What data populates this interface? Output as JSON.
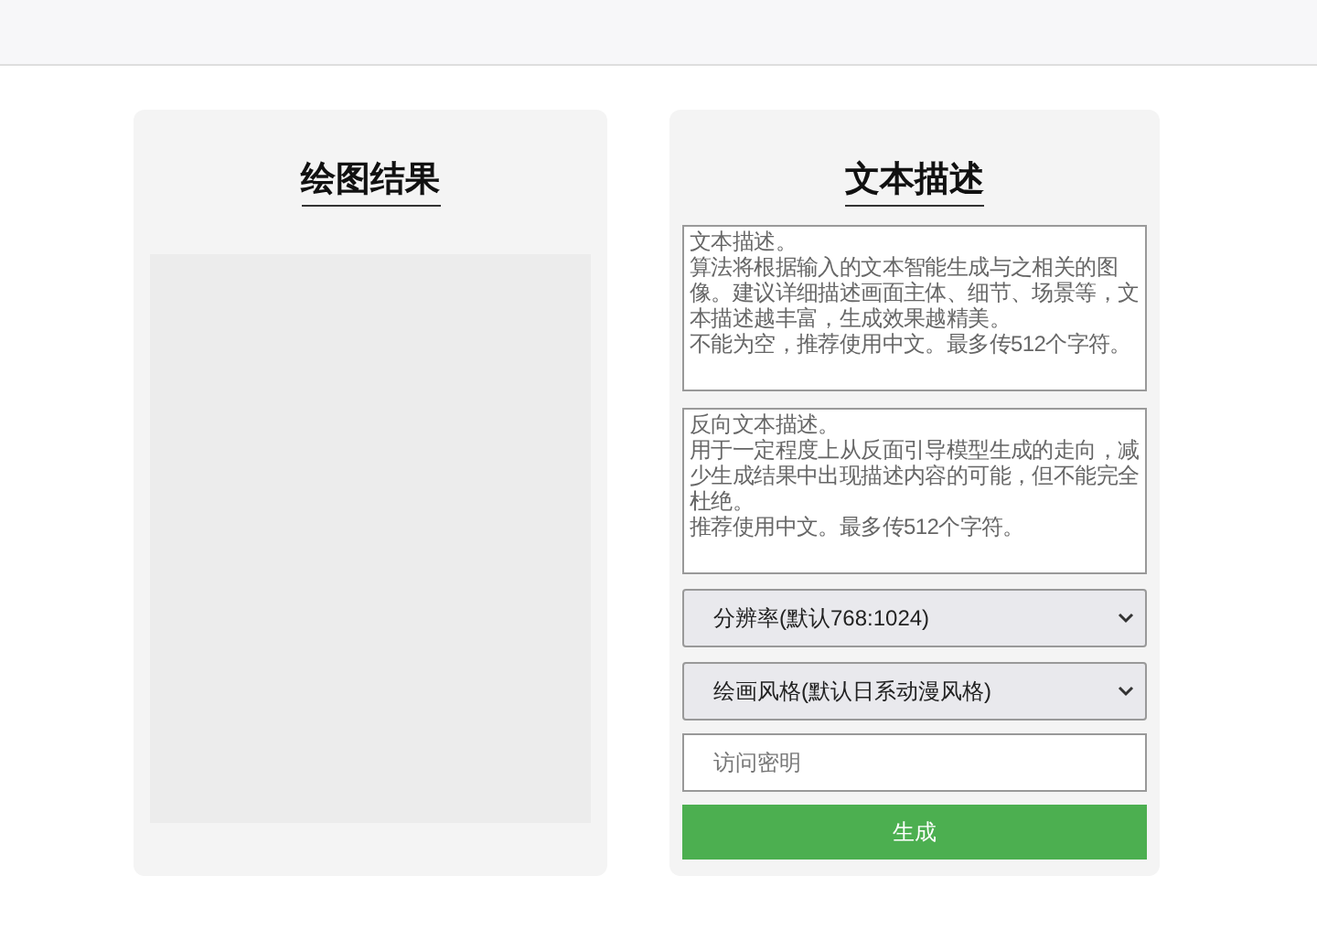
{
  "result_panel": {
    "title": "绘图结果",
    "image_area": {
      "kind": "empty"
    }
  },
  "description_panel": {
    "title": "文本描述",
    "prompt": {
      "placeholder_lines": [
        "文本描述。",
        "算法将根据输入的文本智能生成与之相关的图像。建议详细描述画面主体、细节、场景等，文本描述越丰富，生成效果越精美。",
        "不能为空，推荐使用中文。最多传512个字符。"
      ]
    },
    "negative_prompt": {
      "placeholder_lines": [
        "反向文本描述。",
        "用于一定程度上从反面引导模型生成的走向，减少生成结果中出现描述内容的可能，但不能完全杜绝。",
        "推荐使用中文。最多传512个字符。"
      ]
    },
    "resolution_select": {
      "value": "分辨率(默认768:1024)"
    },
    "style_select": {
      "value": "绘画风格(默认日系动漫风格)"
    },
    "access_key": {
      "placeholder": "访问密明"
    },
    "generate_button": {
      "label": "生成"
    }
  }
}
